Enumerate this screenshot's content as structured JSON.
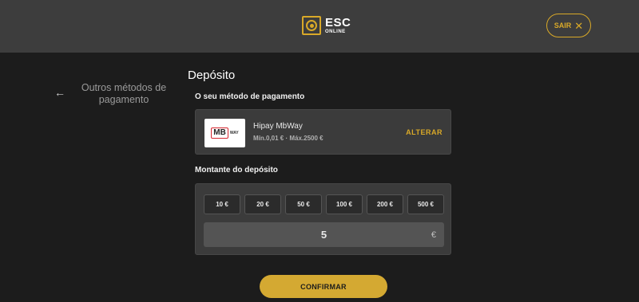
{
  "header": {
    "logo_main": "ESC",
    "logo_sub": "ONLINE",
    "logout_label": "SAIR",
    "logout_icon": "close-icon"
  },
  "sidebar": {
    "back_icon": "arrow-left-icon",
    "back_label": "Outros métodos de pagamento"
  },
  "main": {
    "title": "Depósito",
    "method_section_label": "O seu método de pagamento",
    "method": {
      "logo_text_mb": "MB",
      "logo_text_way": "WAY",
      "name": "Hipay MbWay",
      "limits": "Mín.0,01 € · Máx.2500 €",
      "change_label": "ALTERAR"
    },
    "amount_section_label": "Montante do depósito",
    "quick_amounts": [
      "10 €",
      "20 €",
      "50 €",
      "100 €",
      "200 €",
      "500 €"
    ],
    "amount_value": "5",
    "currency_symbol": "€",
    "confirm_label": "CONFIRMAR"
  },
  "colors": {
    "accent": "#d4a932",
    "header_bg": "#3d3d3d",
    "page_bg": "#1c1c1c",
    "card_bg": "#3b3b3b"
  }
}
